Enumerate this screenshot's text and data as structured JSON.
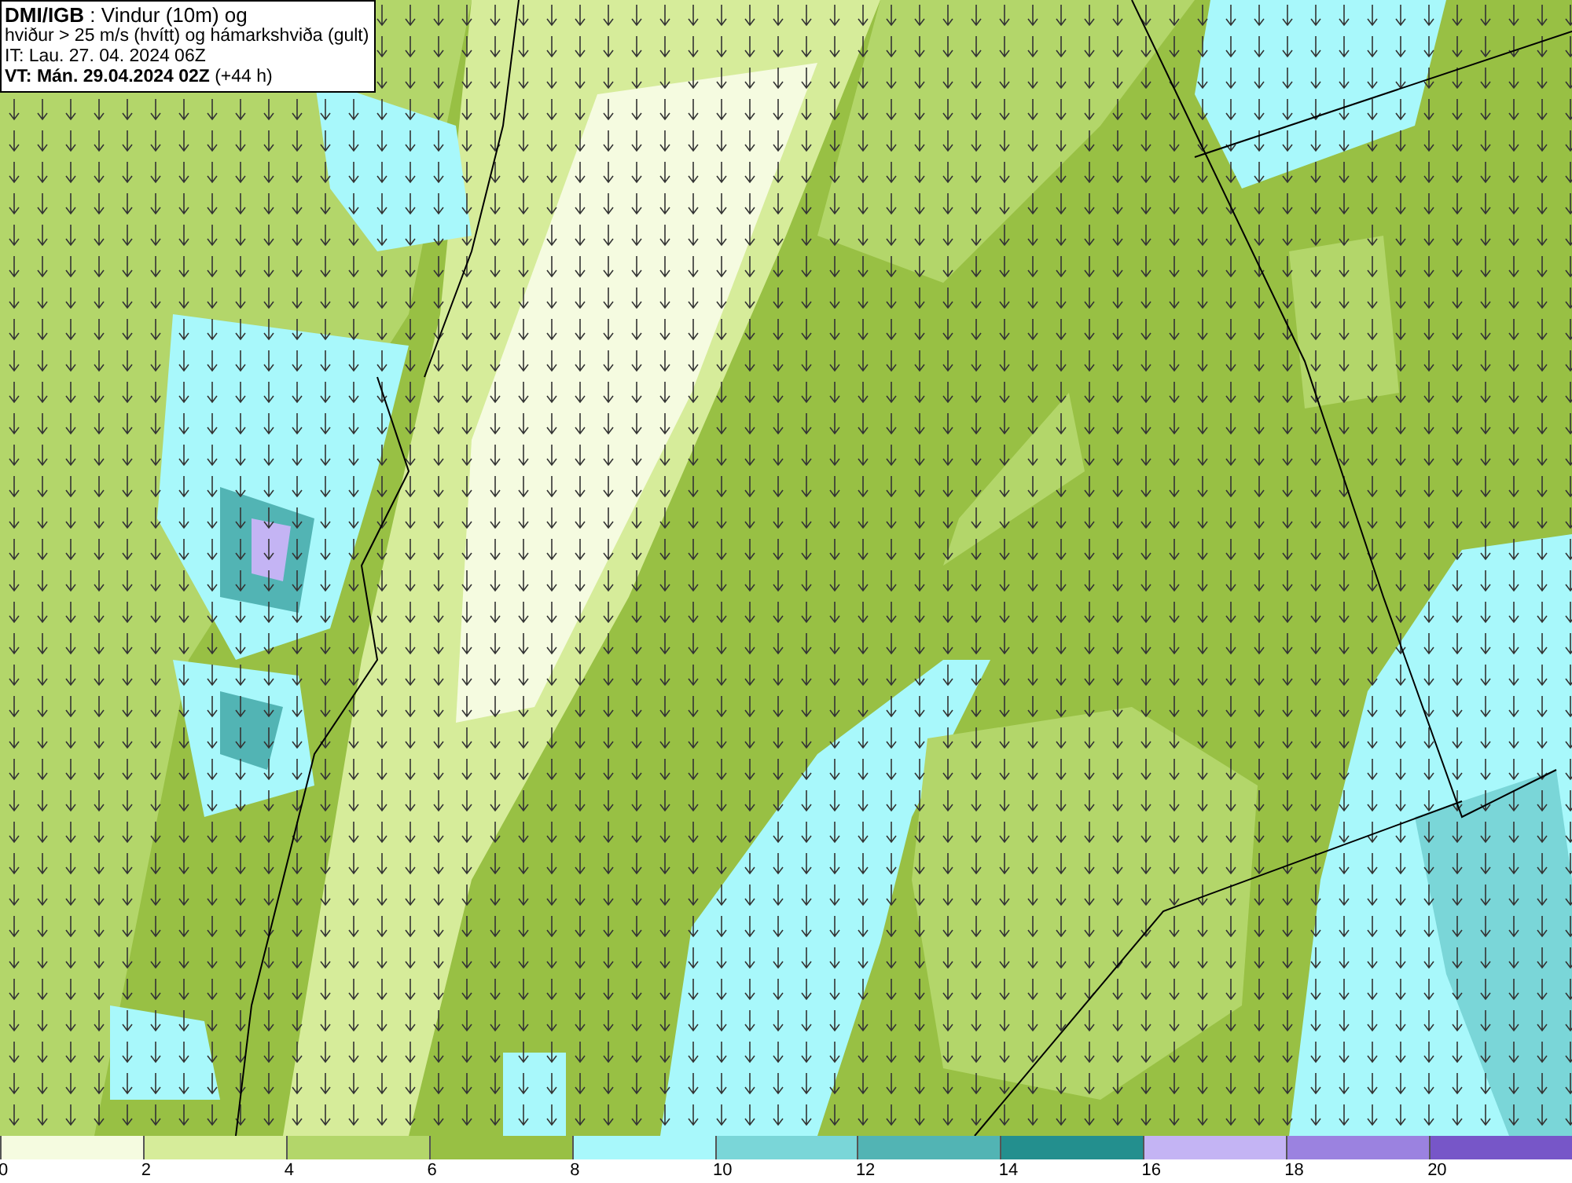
{
  "header": {
    "lines": [
      "**DMI/IGB** : Vindur (10m) og",
      "hviður > 25 m/s (hvítt) og hámarkshviða (gult)",
      "IT: Lau. 27. 04. 2024 06Z",
      "**VT: Mán. 29.04.2024 02Z** (+44 h)"
    ]
  },
  "legend": [
    {
      "color": "#f5fbe0",
      "label": "0"
    },
    {
      "color": "#d6ec9a",
      "label": "2"
    },
    {
      "color": "#b3d66a",
      "label": "4"
    },
    {
      "color": "#98c044",
      "label": "6"
    },
    {
      "color": "#a8f8fb",
      "label": "8"
    },
    {
      "color": "#7ad6d8",
      "label": "10"
    },
    {
      "color": "#52b4b4",
      "label": "12"
    },
    {
      "color": "#238f8e",
      "label": "14"
    },
    {
      "color": "#c4b4f4",
      "label": "16"
    },
    {
      "color": "#9b82e0",
      "label": "18"
    },
    {
      "color": "#7756c8",
      "label": "20"
    }
  ]
}
